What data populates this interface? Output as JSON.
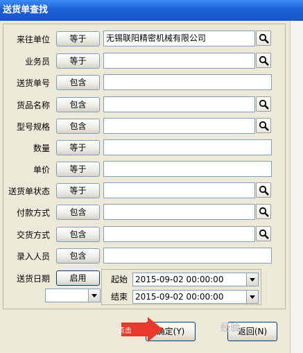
{
  "window": {
    "title": "送货单查找"
  },
  "rows": [
    {
      "label": "来往单位",
      "op": "等于",
      "value": "无锡联阳精密机械有限公司",
      "search": true
    },
    {
      "label": "业务员",
      "op": "等于",
      "value": "",
      "search": true
    },
    {
      "label": "送货单号",
      "op": "包含",
      "value": "",
      "search": false
    },
    {
      "label": "货品名称",
      "op": "包含",
      "value": "",
      "search": true
    },
    {
      "label": "型号规格",
      "op": "包含",
      "value": "",
      "search": true
    },
    {
      "label": "数量",
      "op": "等于",
      "value": "",
      "search": false
    },
    {
      "label": "单价",
      "op": "等于",
      "value": "",
      "search": false
    },
    {
      "label": "送货单状态",
      "op": "等于",
      "value": "",
      "search": true
    },
    {
      "label": "付款方式",
      "op": "包含",
      "value": "",
      "search": true
    },
    {
      "label": "交货方式",
      "op": "包含",
      "value": "",
      "search": true
    },
    {
      "label": "录入人员",
      "op": "包含",
      "value": "",
      "search": false
    }
  ],
  "date": {
    "label": "送货日期",
    "enable_label": "启用",
    "start_label": "起始",
    "start_value": "2015-09-02 00:00:00",
    "end_label": "结束",
    "end_value": "2015-09-02 00:00:00",
    "mode_value": ""
  },
  "buttons": {
    "ok": "确定(Y)",
    "back": "返回(N)"
  },
  "annotation": {
    "text": "点击",
    "color": "#e8392b"
  },
  "watermark": "经验",
  "icons": {
    "search": "magnifier-icon",
    "dropdown": "chevron-down-icon"
  }
}
